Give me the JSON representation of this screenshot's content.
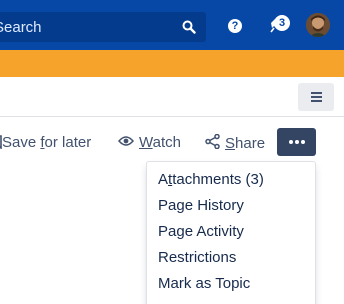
{
  "header": {
    "search_placeholder": "Search",
    "search_icon": "search-icon",
    "help_label": "?",
    "notification_count": "3",
    "colors": {
      "topbar": "#0747a6",
      "banner": "#f6a32c",
      "more_button": "#344563"
    }
  },
  "page_actions": {
    "save_for_later": {
      "before": "Save ",
      "access_key": "f",
      "after": "or later"
    },
    "watch": {
      "access_key": "W",
      "after": "atch"
    },
    "share": {
      "access_key": "S",
      "after": "hare"
    }
  },
  "more_menu": {
    "items": [
      {
        "before": "A",
        "access_key": "t",
        "after": "tachments (3)"
      },
      {
        "label": "Page History"
      },
      {
        "label": "Page Activity"
      },
      {
        "label": "Restrictions"
      },
      {
        "label": "Mark as Topic"
      }
    ]
  }
}
